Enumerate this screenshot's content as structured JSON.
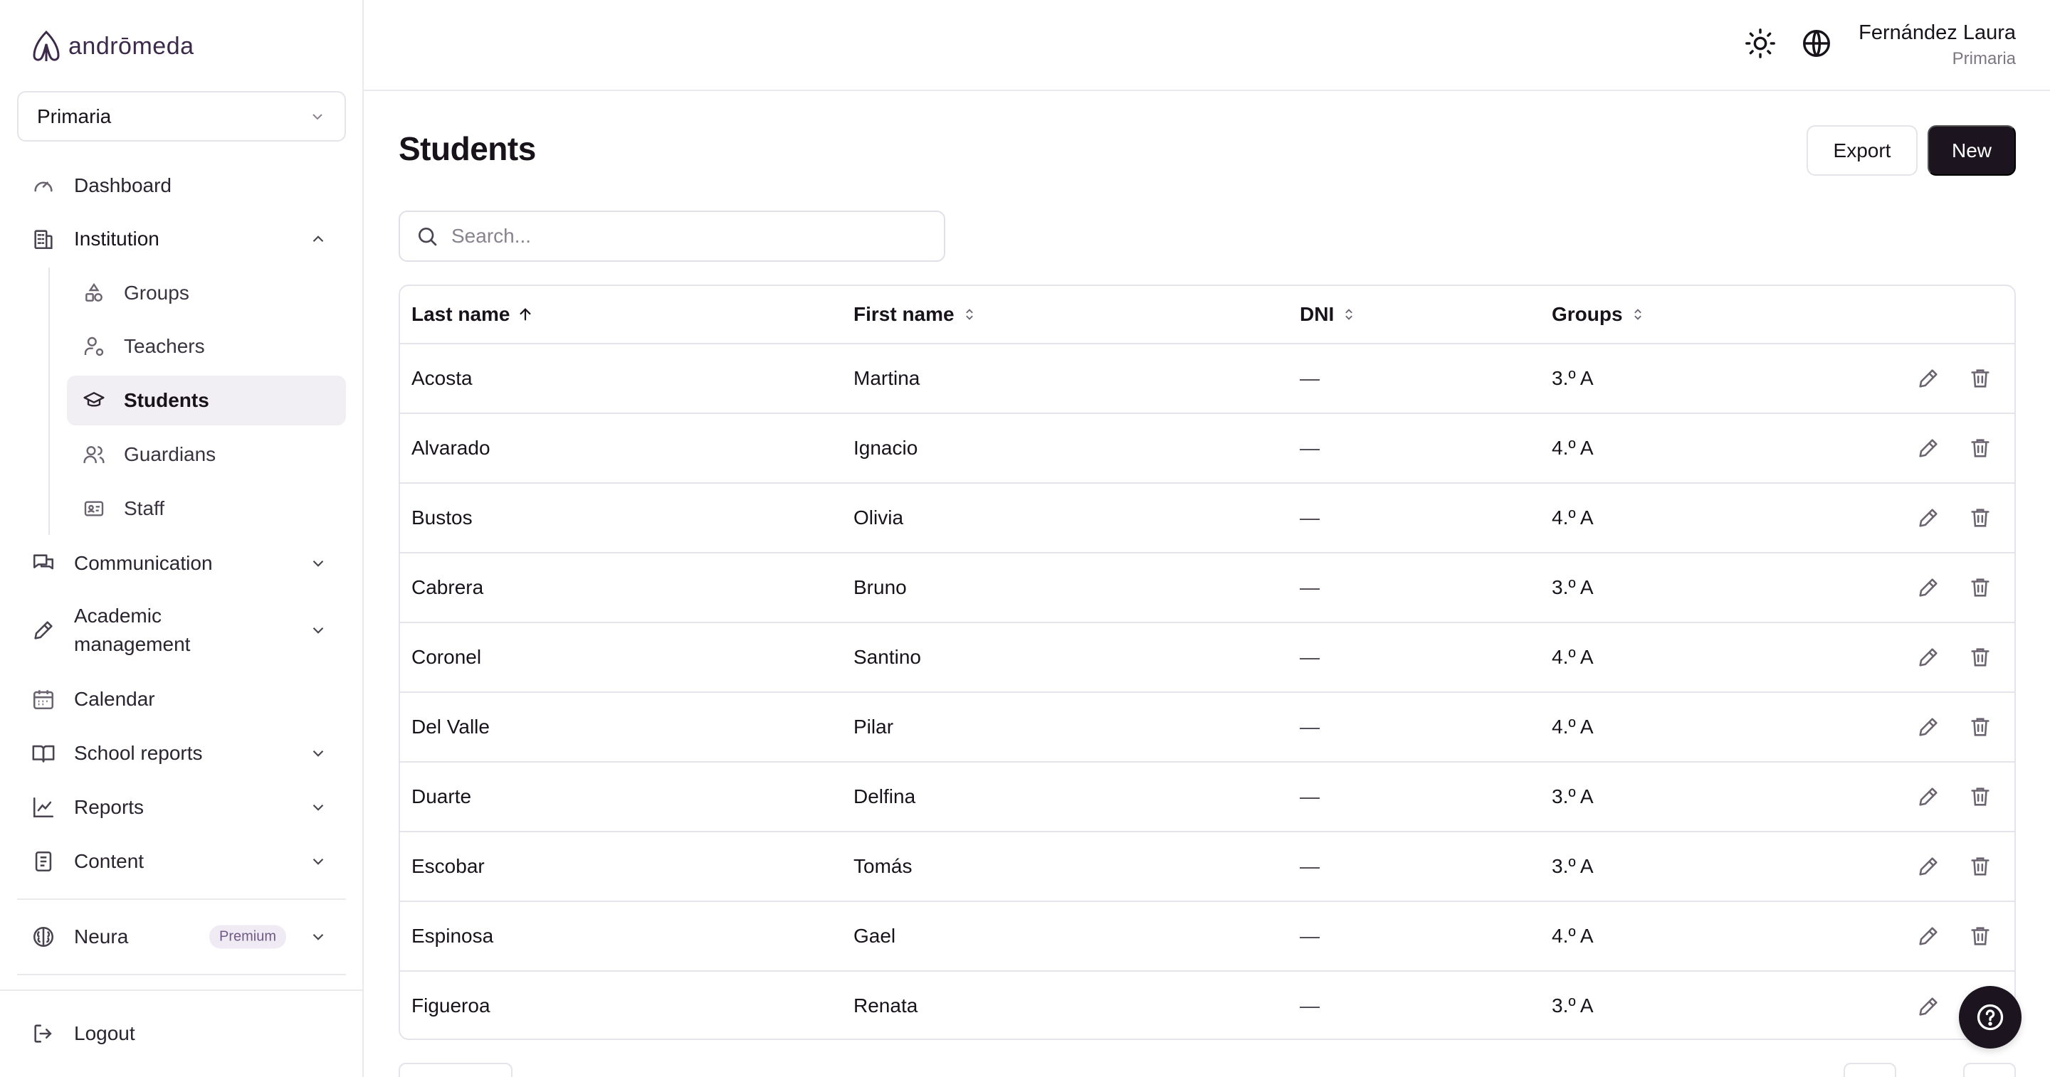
{
  "app": {
    "logo_text": "andrōmeda"
  },
  "sidebar": {
    "level_selector": "Primaria",
    "nav": {
      "dashboard": "Dashboard",
      "institution": "Institution",
      "communication": "Communication",
      "academic_line1": "Academic",
      "academic_line2": "management",
      "calendar": "Calendar",
      "school_reports": "School reports",
      "reports": "Reports",
      "content": "Content",
      "neura": "Neura",
      "neura_badge": "Premium",
      "logout": "Logout"
    },
    "institution_items": {
      "groups": "Groups",
      "teachers": "Teachers",
      "students": "Students",
      "guardians": "Guardians",
      "staff": "Staff"
    }
  },
  "header": {
    "user_name": "Fernández Laura",
    "user_role": "Primaria"
  },
  "main": {
    "title": "Students",
    "export_label": "Export",
    "new_label": "New",
    "search_placeholder": "Search...",
    "columns": {
      "last_name": "Last name",
      "first_name": "First name",
      "dni": "DNI",
      "groups": "Groups"
    },
    "rows": [
      {
        "last": "Acosta",
        "first": "Martina",
        "dni": "—",
        "group": "3.º A"
      },
      {
        "last": "Alvarado",
        "first": "Ignacio",
        "dni": "—",
        "group": "4.º A"
      },
      {
        "last": "Bustos",
        "first": "Olivia",
        "dni": "—",
        "group": "4.º A"
      },
      {
        "last": "Cabrera",
        "first": "Bruno",
        "dni": "—",
        "group": "3.º A"
      },
      {
        "last": "Coronel",
        "first": "Santino",
        "dni": "—",
        "group": "4.º A"
      },
      {
        "last": "Del Valle",
        "first": "Pilar",
        "dni": "—",
        "group": "4.º A"
      },
      {
        "last": "Duarte",
        "first": "Delfina",
        "dni": "—",
        "group": "3.º A"
      },
      {
        "last": "Escobar",
        "first": "Tomás",
        "dni": "—",
        "group": "3.º A"
      },
      {
        "last": "Espinosa",
        "first": "Gael",
        "dni": "—",
        "group": "4.º A"
      },
      {
        "last": "Figueroa",
        "first": "Renata",
        "dni": "—",
        "group": "3.º A"
      }
    ]
  },
  "icons": {
    "brand": "andromeda-logo-icon",
    "theme": "sun-icon",
    "language": "globe-icon",
    "edit": "pencil-icon",
    "delete": "trash-icon",
    "help": "help-circle-icon"
  },
  "colors": {
    "primary": "#1c1520",
    "accent": "#6f5a85",
    "border": "#e6e3ea",
    "selected_bg": "#f1eff3"
  }
}
